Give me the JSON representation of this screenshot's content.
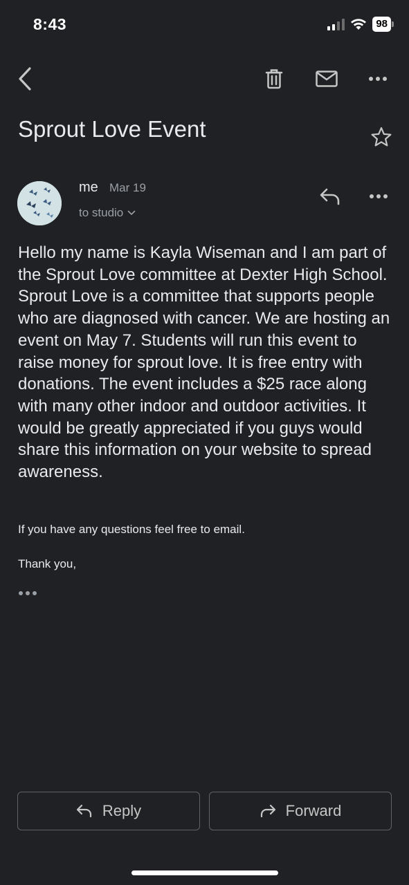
{
  "status": {
    "time": "8:43",
    "battery": "98"
  },
  "toolbar": {
    "icons": [
      "back-arrow-icon",
      "trash-icon",
      "mail-icon",
      "more-icon"
    ]
  },
  "email": {
    "subject": "Sprout Love Event",
    "sender": "me",
    "date": "Mar 19",
    "recipient": "to studio",
    "body": "Hello my name is Kayla Wiseman and I am part of the Sprout Love committee at Dexter High School. Sprout Love is a committee that supports people who are diagnosed with cancer. We are hosting an event on May 7. Students will run this event to raise money for sprout love. It is free entry with donations. The event includes a $25 race along with many other indoor and outdoor activities. It would be greatly appreciated if you guys would share this information on your website to spread awareness.",
    "questions_line": "If you have any questions feel free to email.",
    "closing": "Thank you,"
  },
  "actions": {
    "reply_label": "Reply",
    "forward_label": "Forward"
  },
  "colors": {
    "background": "#202124",
    "text": "#e8eaed",
    "secondary_text": "#9aa0a6",
    "button_border": "#5f6368"
  }
}
